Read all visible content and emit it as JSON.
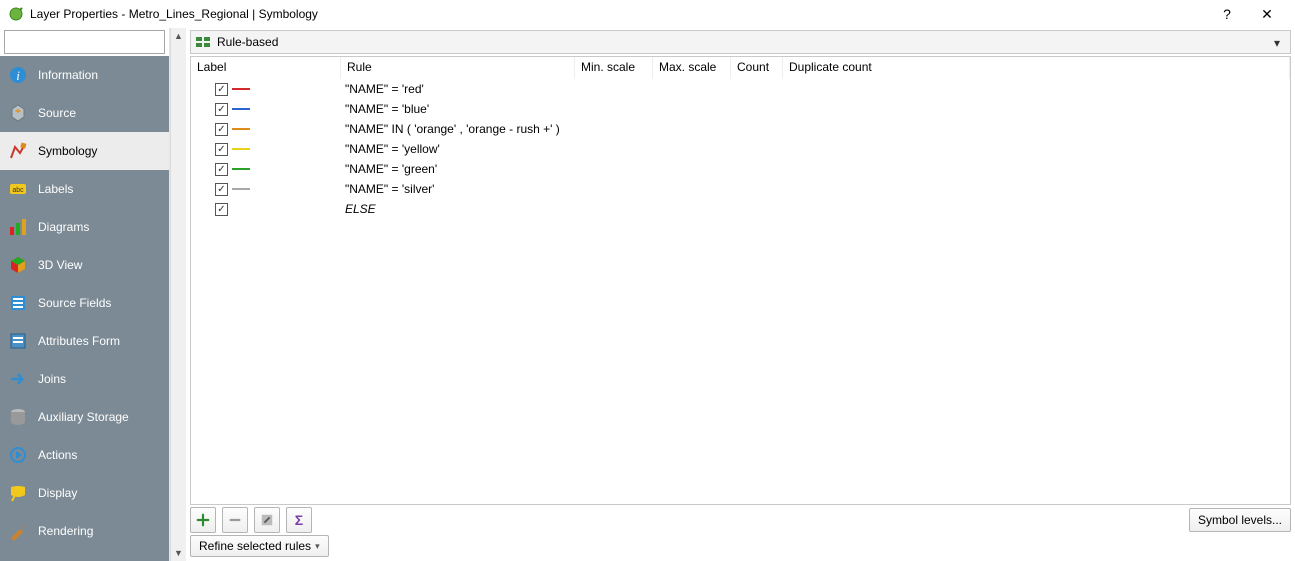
{
  "window": {
    "title": "Layer Properties - Metro_Lines_Regional | Symbology",
    "help_glyph": "?",
    "close_glyph": "✕"
  },
  "search": {
    "placeholder": ""
  },
  "sidebar": {
    "items": [
      {
        "label": "Information",
        "icon": "info"
      },
      {
        "label": "Source",
        "icon": "source"
      },
      {
        "label": "Symbology",
        "icon": "symbology",
        "active": true
      },
      {
        "label": "Labels",
        "icon": "labels"
      },
      {
        "label": "Diagrams",
        "icon": "diagrams"
      },
      {
        "label": "3D View",
        "icon": "3dview"
      },
      {
        "label": "Source Fields",
        "icon": "sourcefields"
      },
      {
        "label": "Attributes Form",
        "icon": "attrform"
      },
      {
        "label": "Joins",
        "icon": "joins"
      },
      {
        "label": "Auxiliary Storage",
        "icon": "auxstorage"
      },
      {
        "label": "Actions",
        "icon": "actions"
      },
      {
        "label": "Display",
        "icon": "display"
      },
      {
        "label": "Rendering",
        "icon": "rendering"
      }
    ]
  },
  "renderer": {
    "label": "Rule-based"
  },
  "rules": {
    "columns": {
      "label": "Label",
      "rule": "Rule",
      "minscale": "Min. scale",
      "maxscale": "Max. scale",
      "count": "Count",
      "dup": "Duplicate count"
    },
    "rows": [
      {
        "checked": true,
        "color": "#d22a2a",
        "rule": "\"NAME\"  = 'red'"
      },
      {
        "checked": true,
        "color": "#2a63d2",
        "rule": "\"NAME\"  = 'blue'"
      },
      {
        "checked": true,
        "color": "#e08a1a",
        "rule": "\"NAME\" IN ( 'orange' ,  'orange - rush +' )"
      },
      {
        "checked": true,
        "color": "#e6d21a",
        "rule": "\"NAME\"  = 'yellow'"
      },
      {
        "checked": true,
        "color": "#2aa22a",
        "rule": "\"NAME\"  = 'green'"
      },
      {
        "checked": true,
        "color": "#a8a8a8",
        "rule": "\"NAME\"  = 'silver'"
      },
      {
        "checked": true,
        "color": "",
        "rule": "ELSE",
        "else": true
      }
    ]
  },
  "toolbar": {
    "add": "+",
    "remove": "−",
    "edit": "✎",
    "sigma": "Σ",
    "symbol_levels": "Symbol levels...",
    "refine": "Refine selected rules"
  }
}
